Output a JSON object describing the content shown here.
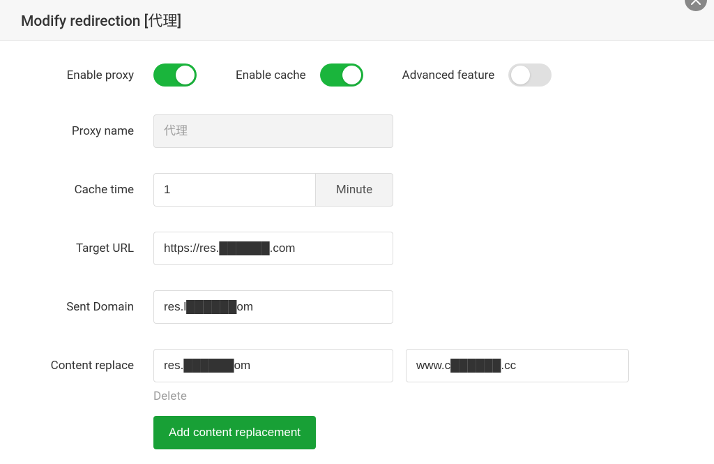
{
  "header": {
    "title": "Modify redirection [代理]"
  },
  "toggles": {
    "enable_proxy_label": "Enable proxy",
    "enable_proxy": true,
    "enable_cache_label": "Enable cache",
    "enable_cache": true,
    "advanced_label": "Advanced feature",
    "advanced": false
  },
  "fields": {
    "proxy_name_label": "Proxy name",
    "proxy_name_placeholder": "代理",
    "proxy_name_value": "",
    "cache_time_label": "Cache time",
    "cache_time_value": "1",
    "cache_time_unit": "Minute",
    "target_url_label": "Target URL",
    "target_url_value": "https://res.██████.com",
    "sent_domain_label": "Sent Domain",
    "sent_domain_value": "res.l██████om",
    "content_replace_label": "Content replace",
    "content_replace_from": "res.██████om",
    "content_replace_to": "www.c██████.cc"
  },
  "actions": {
    "delete_label": "Delete",
    "add_replacement_label": "Add content replacement"
  }
}
